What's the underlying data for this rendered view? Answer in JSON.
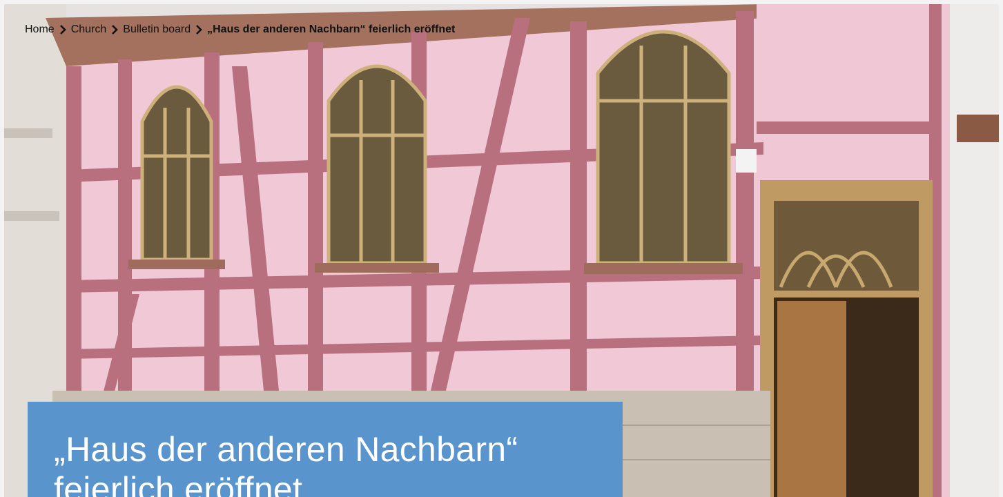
{
  "breadcrumb": {
    "items": [
      {
        "label": "Home"
      },
      {
        "label": "Church"
      },
      {
        "label": "Bulletin board"
      }
    ],
    "current": "„Haus der anderen Nachbarn“ feierlich eröffnet"
  },
  "hero": {
    "title": "„Haus der anderen Nachbarn“ feierlich eröffnet",
    "accent_color": "#5a94cc"
  }
}
